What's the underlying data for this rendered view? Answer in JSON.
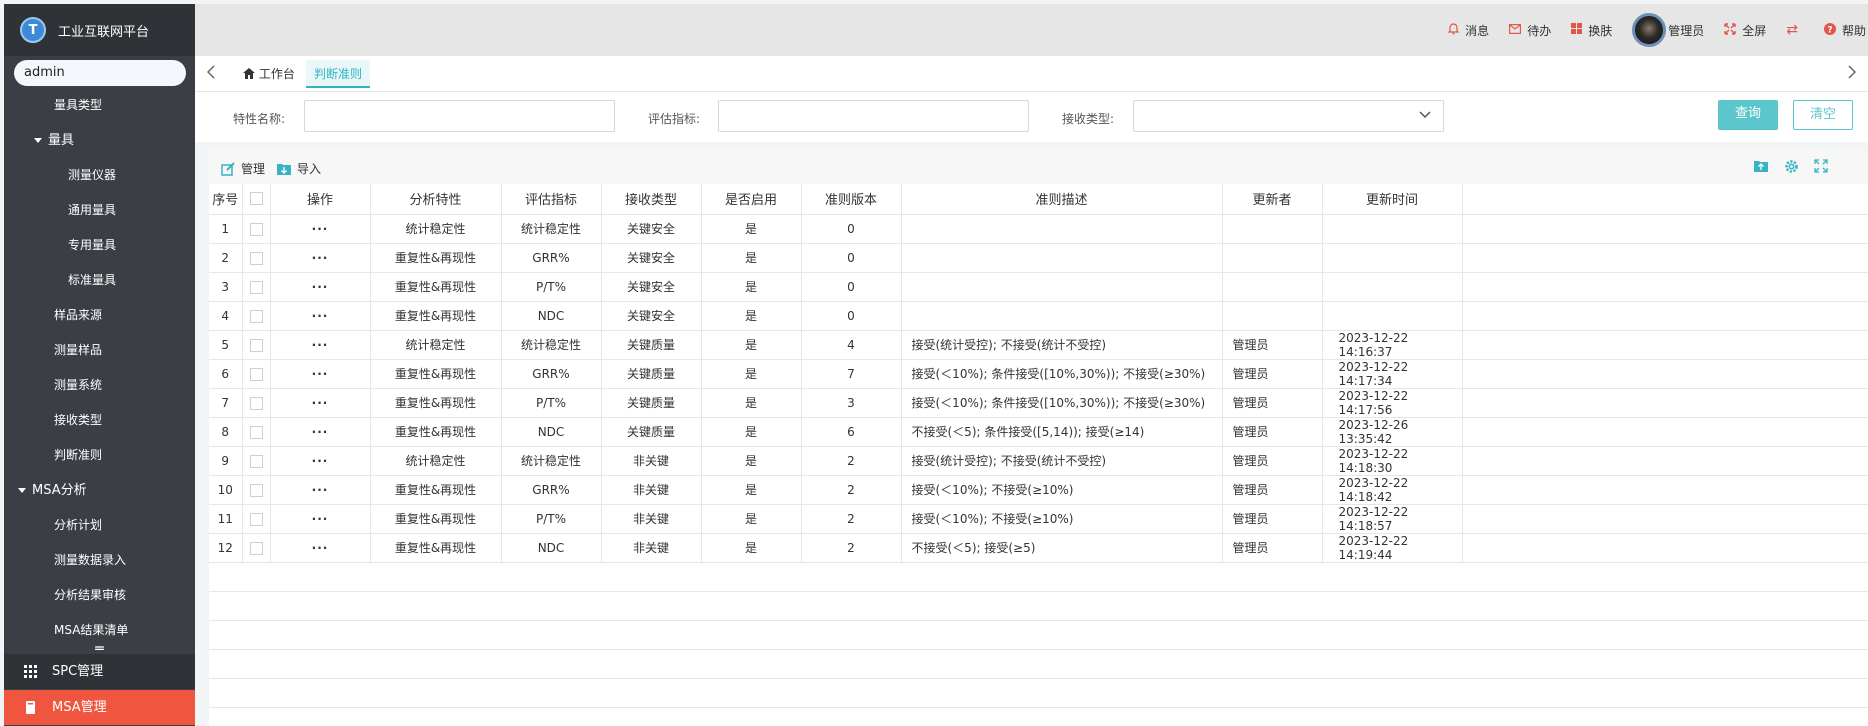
{
  "app": {
    "title": "工业互联网平台",
    "logo_letter": "T"
  },
  "sidebar": {
    "search_value": "admin",
    "items": [
      {
        "label": "量具类型",
        "level": "l1"
      },
      {
        "label": "量具",
        "level": "group"
      },
      {
        "label": "测量仪器",
        "level": "l2"
      },
      {
        "label": "通用量具",
        "level": "l2"
      },
      {
        "label": "专用量具",
        "level": "l2"
      },
      {
        "label": "标准量具",
        "level": "l2"
      },
      {
        "label": "样品来源",
        "level": "l1"
      },
      {
        "label": "测量样品",
        "level": "l1"
      },
      {
        "label": "测量系统",
        "level": "l1"
      },
      {
        "label": "接收类型",
        "level": "l1"
      },
      {
        "label": "判断准则",
        "level": "l1"
      },
      {
        "label": "MSA分析",
        "level": "group0"
      },
      {
        "label": "分析计划",
        "level": "l1"
      },
      {
        "label": "测量数据录入",
        "level": "l1"
      },
      {
        "label": "分析结果审核",
        "level": "l1"
      },
      {
        "label": "MSA结果清单",
        "level": "l1"
      }
    ],
    "hamburger": "═",
    "bottom": {
      "spc": "SPC管理",
      "msa": "MSA管理"
    }
  },
  "topbar": {
    "message": "消息",
    "todo": "待办",
    "skin": "换肤",
    "user": "管理员",
    "fullscreen": "全屏",
    "switch_icon": "⇄",
    "help": "帮助"
  },
  "tabs": {
    "home": "工作台",
    "active": "判断准则"
  },
  "filters": {
    "feature_label": "特性名称:",
    "feature_value": "",
    "index_label": "评估指标:",
    "index_value": "",
    "accept_label": "接收类型:",
    "accept_value": "",
    "query": "查询",
    "clear": "清空"
  },
  "toolbar": {
    "manage": "管理",
    "import": "导入"
  },
  "table": {
    "headers": [
      "序号",
      "操作",
      "分析特性",
      "评估指标",
      "接收类型",
      "是否启用",
      "准则版本",
      "准则描述",
      "更新者",
      "更新时间"
    ],
    "rows": [
      {
        "no": "1",
        "op": "···",
        "feature": "统计稳定性",
        "index": "统计稳定性",
        "type": "关键安全",
        "enabled": "是",
        "version": "0",
        "desc": "",
        "updater": "",
        "time": ""
      },
      {
        "no": "2",
        "op": "···",
        "feature": "重复性&再现性",
        "index": "GRR%",
        "type": "关键安全",
        "enabled": "是",
        "version": "0",
        "desc": "",
        "updater": "",
        "time": ""
      },
      {
        "no": "3",
        "op": "···",
        "feature": "重复性&再现性",
        "index": "P/T%",
        "type": "关键安全",
        "enabled": "是",
        "version": "0",
        "desc": "",
        "updater": "",
        "time": ""
      },
      {
        "no": "4",
        "op": "···",
        "feature": "重复性&再现性",
        "index": "NDC",
        "type": "关键安全",
        "enabled": "是",
        "version": "0",
        "desc": "",
        "updater": "",
        "time": ""
      },
      {
        "no": "5",
        "op": "···",
        "feature": "统计稳定性",
        "index": "统计稳定性",
        "type": "关键质量",
        "enabled": "是",
        "version": "4",
        "desc": "接受(统计受控); 不接受(统计不受控)",
        "updater": "管理员",
        "time": "2023-12-22 14:16:37"
      },
      {
        "no": "6",
        "op": "···",
        "feature": "重复性&再现性",
        "index": "GRR%",
        "type": "关键质量",
        "enabled": "是",
        "version": "7",
        "desc": "接受(＜10%); 条件接受([10%,30%)); 不接受(≥30%)",
        "updater": "管理员",
        "time": "2023-12-22 14:17:34"
      },
      {
        "no": "7",
        "op": "···",
        "feature": "重复性&再现性",
        "index": "P/T%",
        "type": "关键质量",
        "enabled": "是",
        "version": "3",
        "desc": "接受(＜10%); 条件接受([10%,30%)); 不接受(≥30%)",
        "updater": "管理员",
        "time": "2023-12-22 14:17:56"
      },
      {
        "no": "8",
        "op": "···",
        "feature": "重复性&再现性",
        "index": "NDC",
        "type": "关键质量",
        "enabled": "是",
        "version": "6",
        "desc": "不接受(＜5); 条件接受([5,14)); 接受(≥14)",
        "updater": "管理员",
        "time": "2023-12-26 13:35:42"
      },
      {
        "no": "9",
        "op": "···",
        "feature": "统计稳定性",
        "index": "统计稳定性",
        "type": "非关键",
        "enabled": "是",
        "version": "2",
        "desc": "接受(统计受控); 不接受(统计不受控)",
        "updater": "管理员",
        "time": "2023-12-22 14:18:30"
      },
      {
        "no": "10",
        "op": "···",
        "feature": "重复性&再现性",
        "index": "GRR%",
        "type": "非关键",
        "enabled": "是",
        "version": "2",
        "desc": "接受(＜10%); 不接受(≥10%)",
        "updater": "管理员",
        "time": "2023-12-22 14:18:42"
      },
      {
        "no": "11",
        "op": "···",
        "feature": "重复性&再现性",
        "index": "P/T%",
        "type": "非关键",
        "enabled": "是",
        "version": "2",
        "desc": "接受(＜10%); 不接受(≥10%)",
        "updater": "管理员",
        "time": "2023-12-22 14:18:57"
      },
      {
        "no": "12",
        "op": "···",
        "feature": "重复性&再现性",
        "index": "NDC",
        "type": "非关键",
        "enabled": "是",
        "version": "2",
        "desc": "不接受(＜5); 接受(≥5)",
        "updater": "管理员",
        "time": "2023-12-22 14:19:44"
      }
    ]
  },
  "colors": {
    "accent": "#5bc7cd",
    "sidebar": "#3b3e44",
    "active_bottom": "#f0553f",
    "icon_red": "#e2574c"
  }
}
